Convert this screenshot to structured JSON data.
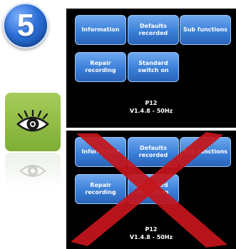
{
  "step_number": "5",
  "top_screen": {
    "buttons": [
      {
        "label": "Information"
      },
      {
        "label": "Defaults\nrecorded"
      },
      {
        "label": "Sub functions"
      },
      {
        "label": "Repair\nrecording"
      },
      {
        "label": "Standard\nswitch on"
      }
    ],
    "footer_line1": "P12",
    "footer_line2": "V1.4.8 - 50Hz"
  },
  "bottom_screen": {
    "buttons": [
      {
        "label": "Information"
      },
      {
        "label": "Defaults\nrecorded"
      },
      {
        "label": "Sub functions"
      },
      {
        "label": "Repair\nrecording"
      },
      {
        "label": "Standard\nswitch on"
      }
    ],
    "footer_line1": "P12",
    "footer_line2": "V1.4.8 - 50Hz",
    "crossed_out": true
  },
  "icons": {
    "step": "step-number-badge",
    "view": "eye-icon",
    "cross": "red-cross-icon"
  },
  "colors": {
    "button_blue": "#3a7fd8",
    "eye_tile_green": "#8cba44",
    "cross_red": "#c4161c",
    "screen_bg": "#000000"
  }
}
